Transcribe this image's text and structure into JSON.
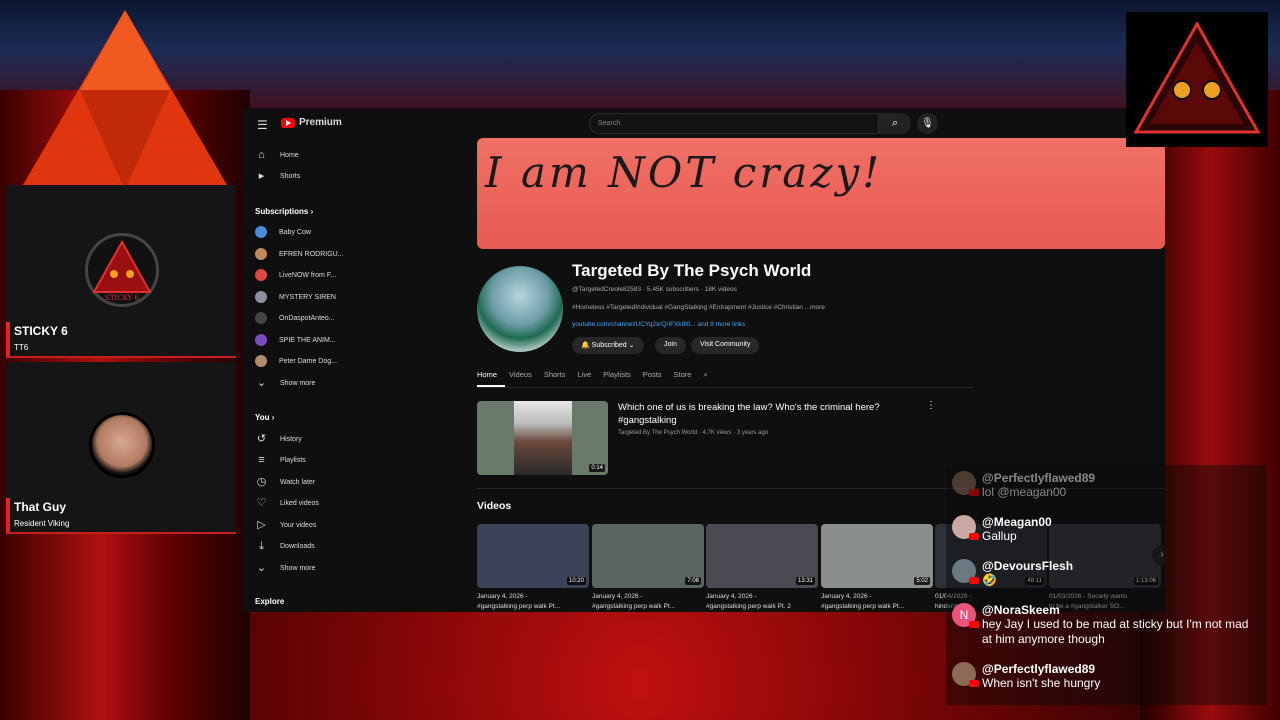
{
  "overlay": {
    "cams": [
      {
        "name": "STICKY 6",
        "subtitle": "TT6",
        "avatar_text": "STICKY 6"
      },
      {
        "name": "That Guy",
        "subtitle": "Resident Viking"
      }
    ],
    "accent": "#c81e1e"
  },
  "youtube": {
    "logo": "Premium",
    "search": {
      "placeholder": "Search"
    },
    "sidebar": {
      "main": [
        {
          "label": "Home",
          "icon": "home-icon"
        },
        {
          "label": "Shorts",
          "icon": "shorts-icon"
        }
      ],
      "subscriptions_header": "Subscriptions",
      "subscriptions": [
        {
          "label": "Baby Cow",
          "color": "#4b8bd8"
        },
        {
          "label": "EFREN RODRIGU...",
          "color": "#c08a5a"
        },
        {
          "label": "LiveNOW from F...",
          "color": "#e04848"
        },
        {
          "label": "MYSTERY SIREN",
          "color": "#8a8fa0"
        },
        {
          "label": "OnDaspotAnteo...",
          "color": "#444"
        },
        {
          "label": "SPIE THE ANIM...",
          "color": "#7a48c0"
        },
        {
          "label": "Peter Dame Dog...",
          "color": "#b08a6a"
        }
      ],
      "show_more": "Show more",
      "you_header": "You",
      "you": [
        {
          "label": "History",
          "icon": "history-icon"
        },
        {
          "label": "Playlists",
          "icon": "playlists-icon"
        },
        {
          "label": "Watch later",
          "icon": "clock-icon"
        },
        {
          "label": "Liked videos",
          "icon": "like-icon"
        },
        {
          "label": "Your videos",
          "icon": "video-icon"
        },
        {
          "label": "Downloads",
          "icon": "download-icon"
        }
      ],
      "show_more_2": "Show more",
      "explore_header": "Explore"
    },
    "channel": {
      "banner_text": "I am NOT crazy!",
      "title": "Targeted By The Psych World",
      "meta": "@TargetedCreole82583 · 5.45K subscribers · 18K videos",
      "desc": "#Homeless #TargetedIndividual #GangStalking #Entrapment #Justice #Christian ...more",
      "links": "youtube.com/channel/UCYq2xrQnFXk8l0... and 9 more links",
      "buttons": {
        "subscribed": "Subscribed",
        "join": "Join",
        "community": "Visit Community"
      },
      "tabs": [
        "Home",
        "Videos",
        "Shorts",
        "Live",
        "Playlists",
        "Posts",
        "Store"
      ],
      "active_tab": "Home"
    },
    "featured": {
      "title": "Which one of us is breaking the law? Who's the criminal here? #gangstalking",
      "meta": "Targeted By The Psych World · 4.7K views · 3 years ago",
      "duration": "0:14"
    },
    "videos_header": "Videos",
    "videos": [
      {
        "date": "January 4, 2026 -",
        "title": "#gangstalking perp walk Pt...",
        "duration": "10:20",
        "color": "#3b4257"
      },
      {
        "date": "January 4, 2026 -",
        "title": "#gangstalking perp walk Pt...",
        "duration": "7:08",
        "color": "#5a6460"
      },
      {
        "date": "January 4, 2026 -",
        "title": "#gangstalking perp walk Pt. 2",
        "duration": "13:31",
        "color": "#4a4a52"
      },
      {
        "date": "January 4, 2026 -",
        "title": "#gangstalking perp walk Pt...",
        "duration": "5:02",
        "color": "#8a8e8c"
      },
      {
        "date": "01/04/2026 -",
        "title": "hindering...",
        "duration": "48:11",
        "color": "#2d3138"
      },
      {
        "date": "01/03/2026 - Society wants",
        "title": "to be a #gangstalker SO...",
        "duration": "1:13:06",
        "color": "#3a3a40"
      }
    ]
  },
  "chat": [
    {
      "name": "@Perfectlyflawed89",
      "text": "lol @meagan00",
      "avatar_color": "#8a6a55"
    },
    {
      "name": "@Meagan00",
      "text": "Gallup",
      "avatar_color": "#c9a9a0"
    },
    {
      "name": "@DevoursFlesh",
      "text": "🤣",
      "avatar_color": "#6a7a80"
    },
    {
      "name": "@NoraSkeem",
      "text": "hey Jay I used to be mad at sticky but I'm not mad at him anymore though",
      "avatar_letter": "N",
      "avatar_color": "#e8557a"
    },
    {
      "name": "@Perfectlyflawed89",
      "text": "When isn't she hungry",
      "avatar_color": "#8a6a55"
    }
  ]
}
